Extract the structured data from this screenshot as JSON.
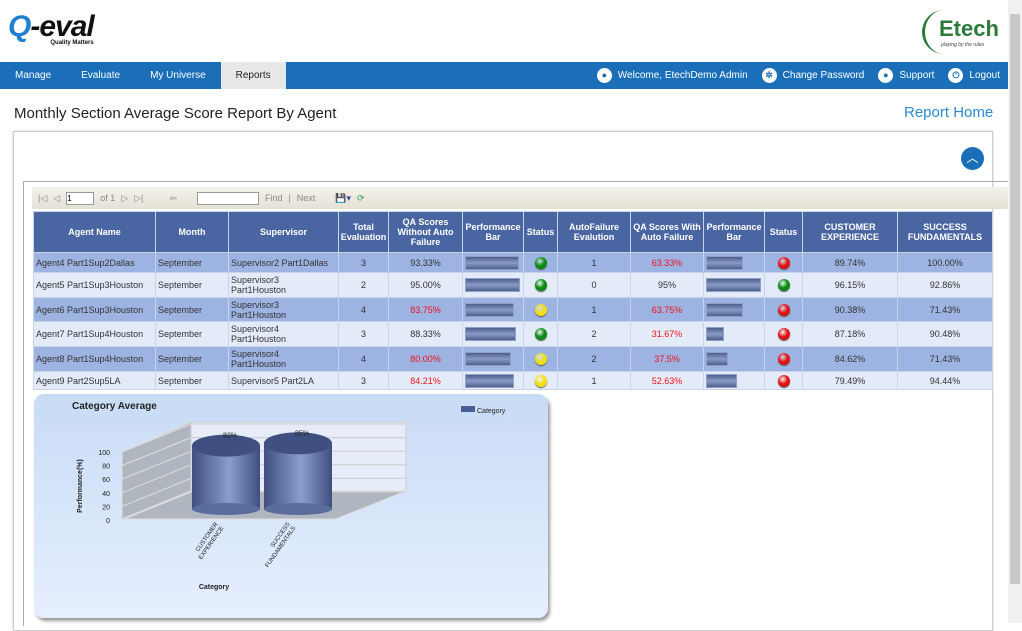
{
  "header": {
    "logo_left": "Q-eval",
    "logo_left_tagline": "Quality Matters",
    "logo_right": "Etech",
    "logo_right_tagline": "playing by the rules"
  },
  "nav": {
    "items": [
      {
        "label": "Manage"
      },
      {
        "label": "Evaluate"
      },
      {
        "label": "My Universe"
      },
      {
        "label": "Reports",
        "active": true
      }
    ],
    "right": [
      {
        "label": "Welcome, EtechDemo Admin",
        "icon": "user-icon"
      },
      {
        "label": "Change Password",
        "icon": "gear-icon"
      },
      {
        "label": "Support",
        "icon": "support-icon"
      },
      {
        "label": "Logout",
        "icon": "power-icon"
      }
    ],
    "color": "#1a6fb8"
  },
  "page": {
    "title": "Monthly Section Average Score Report By Agent",
    "report_home": "Report Home"
  },
  "toolbar": {
    "page": "1",
    "of": "of 1",
    "find": "Find",
    "sep": "|",
    "next": "Next",
    "search_value": ""
  },
  "table": {
    "headers": [
      "Agent Name",
      "Month",
      "Supervisor",
      "Total Evaluation",
      "QA Scores Without Auto Failure",
      "Performance Bar",
      "Status",
      "AutoFailure Evalution",
      "QA Scores With Auto Failure",
      "Performance Bar",
      "Status",
      "CUSTOMER EXPERIENCE",
      "SUCCESS FUNDAMENTALS"
    ],
    "rows": [
      {
        "agent": "Agent4 Part1Sup2Dallas",
        "month": "September",
        "supervisor": "Supervisor2 Part1Dallas",
        "total": "3",
        "qa": "93.33%",
        "qa_red": false,
        "bar1": 93.33,
        "status1": "green",
        "af": "1",
        "qa_af": "63.33%",
        "qa_af_red": true,
        "bar2": 63.33,
        "status2": "red",
        "cx": "89.74%",
        "sf": "100.00%"
      },
      {
        "agent": "Agent5 Part1Sup3Houston",
        "month": "September",
        "supervisor": "Supervisor3 Part1Houston",
        "total": "2",
        "qa": "95.00%",
        "qa_red": false,
        "bar1": 95,
        "status1": "green",
        "af": "0",
        "qa_af": "95%",
        "qa_af_red": false,
        "bar2": 95,
        "status2": "green",
        "cx": "96.15%",
        "sf": "92.86%"
      },
      {
        "agent": "Agent6 Part1Sup3Houston",
        "month": "September",
        "supervisor": "Supervisor3 Part1Houston",
        "total": "4",
        "qa": "83.75%",
        "qa_red": true,
        "bar1": 83.75,
        "status1": "yellow",
        "af": "1",
        "qa_af": "63.75%",
        "qa_af_red": true,
        "bar2": 63.75,
        "status2": "red",
        "cx": "90.38%",
        "sf": "71.43%"
      },
      {
        "agent": "Agent7 Part1Sup4Houston",
        "month": "September",
        "supervisor": "Supervisor4 Part1Houston",
        "total": "3",
        "qa": "88.33%",
        "qa_red": false,
        "bar1": 88.33,
        "status1": "green",
        "af": "2",
        "qa_af": "31.67%",
        "qa_af_red": true,
        "bar2": 31.67,
        "status2": "red",
        "cx": "87.18%",
        "sf": "90.48%"
      },
      {
        "agent": "Agent8 Part1Sup4Houston",
        "month": "September",
        "supervisor": "Supervisor4 Part1Houston",
        "total": "4",
        "qa": "80.00%",
        "qa_red": true,
        "bar1": 80,
        "status1": "yellow",
        "af": "2",
        "qa_af": "37.5%",
        "qa_af_red": true,
        "bar2": 37.5,
        "status2": "red",
        "cx": "84.62%",
        "sf": "71.43%"
      },
      {
        "agent": "Agent9 Part2Sup5LA",
        "month": "September",
        "supervisor": "Supervisor5 Part2LA",
        "total": "3",
        "qa": "84.21%",
        "qa_red": true,
        "bar1": 84.21,
        "status1": "yellow",
        "af": "1",
        "qa_af": "52.63%",
        "qa_af_red": true,
        "bar2": 52.63,
        "status2": "red",
        "cx": "79.49%",
        "sf": "94.44%"
      }
    ]
  },
  "status_colors": {
    "green": "#0a8a10",
    "yellow": "#f0e010",
    "red": "#e01010"
  },
  "chart_data": {
    "type": "bar",
    "title": "Category Average",
    "categories": [
      "CUSTOMER EXPERIENCE",
      "SUCCESS FUNDAMENTALS"
    ],
    "series": [
      {
        "name": "Category",
        "values": [
          82,
          85
        ]
      }
    ],
    "data_labels": [
      "82%",
      "85%"
    ],
    "xlabel": "Category",
    "ylabel": "Performance(%)",
    "ylim": [
      0,
      100
    ],
    "yticks": [
      "0",
      "20",
      "40",
      "60",
      "80",
      "100"
    ],
    "legend": "top-right",
    "grid": true,
    "style": "3d-cylinder",
    "color": "#4a5e96"
  }
}
